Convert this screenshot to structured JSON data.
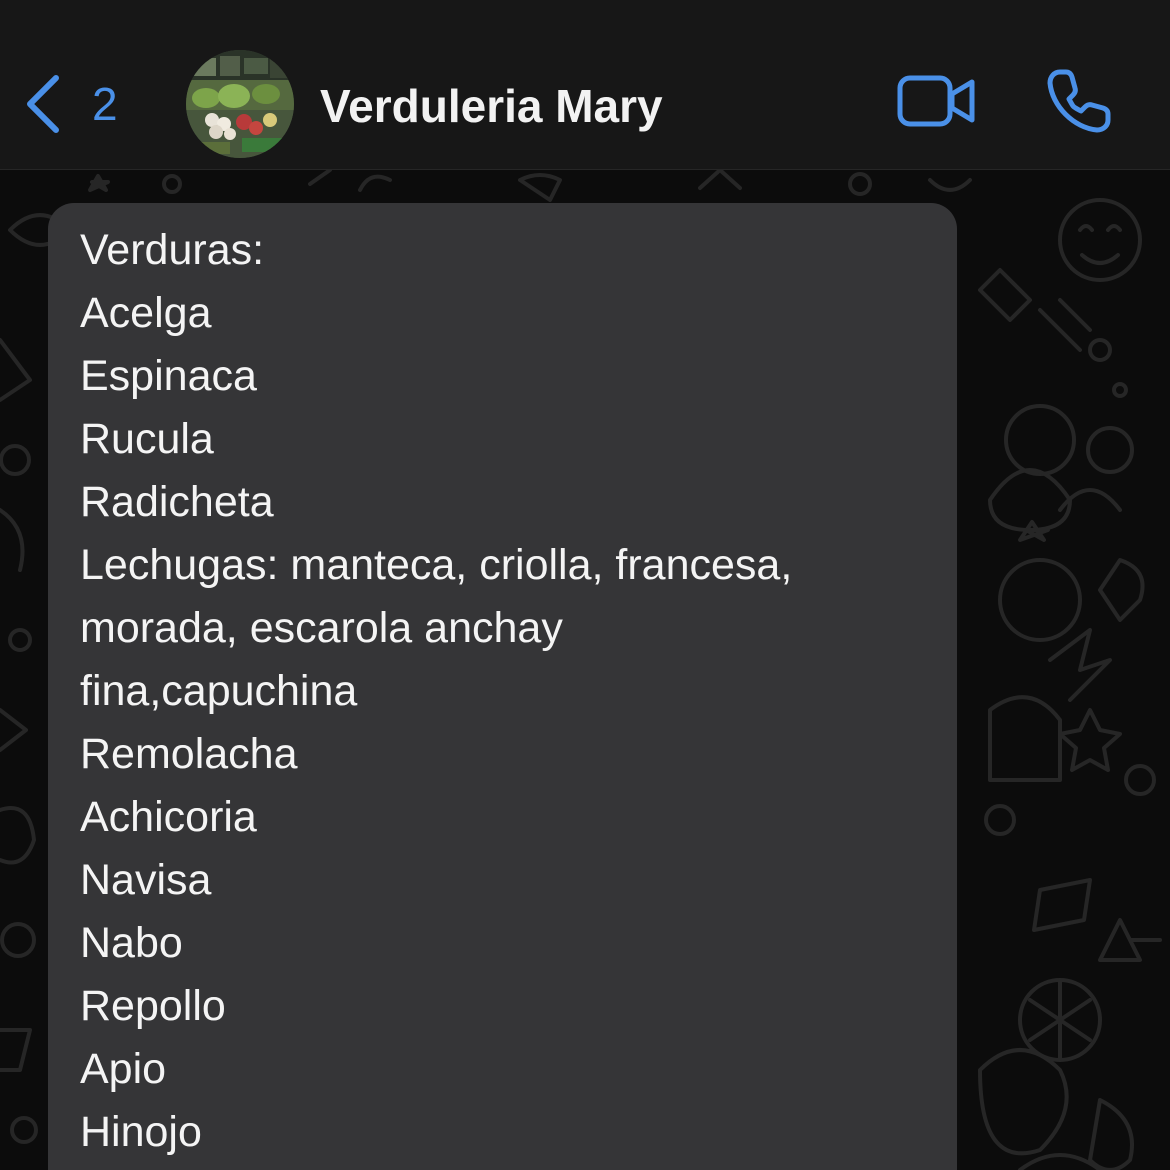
{
  "header": {
    "back_count": "2",
    "contact_name": "Verduleria Mary",
    "accent_color": "#4a90e8",
    "icons": [
      "chevron-left-icon",
      "video-camera-icon",
      "phone-icon"
    ]
  },
  "message": {
    "lines": [
      "Verduras:",
      "Acelga",
      "Espinaca",
      "Rucula",
      "Radicheta",
      "Lechugas: manteca, criolla, francesa,",
      "morada, escarola anchay",
      "fina,capuchina",
      "Remolacha",
      "Achicoria",
      "Navisa",
      "Nabo",
      "Repollo",
      "Apio",
      "Hinojo"
    ]
  }
}
